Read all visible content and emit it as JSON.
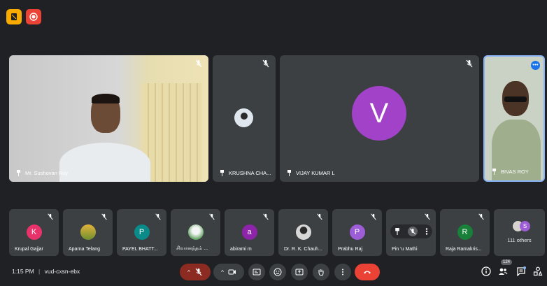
{
  "top_icons": [
    "files-icon",
    "record-icon"
  ],
  "main_tiles": [
    {
      "name": "Mr. Sushovan Roy"
    },
    {
      "name": "KRUSHNA CHA..."
    },
    {
      "name": "VIJAY KUMAR L",
      "avatar_letter": "V",
      "avatar_color": "#a142c9"
    },
    {
      "name": "BIVAS ROY"
    }
  ],
  "small_tiles": [
    {
      "name": "Krupal Gajjar",
      "letter": "K",
      "color": "#e8336a"
    },
    {
      "name": "Aparna Telang",
      "letter": "",
      "color": "#7a9a3a"
    },
    {
      "name": "PAYEL BHATT...",
      "letter": "P",
      "color": "#0b8a8a"
    },
    {
      "name": "சிவானந்தம் ...",
      "letter": "",
      "color": "#6aa86a"
    },
    {
      "name": "abirami m",
      "letter": "a",
      "color": "#8e24aa"
    },
    {
      "name": "Dr. R. K. Chauh...",
      "letter": "",
      "color": "#555"
    },
    {
      "name": "Prabhu Raj",
      "letter": "P",
      "color": "#9c5dd6"
    },
    {
      "name": "Pin   ‘u Mathi",
      "letter": "",
      "color": "#3c4043"
    },
    {
      "name": "Raja Ramakris...",
      "letter": "R",
      "color": "#188038"
    },
    {
      "name": "111 others",
      "letter": "S",
      "color": "#9c5dd6"
    }
  ],
  "bottom": {
    "time": "1:15 PM",
    "separator": "|",
    "meeting_code": "vud-cxsn-ebx",
    "people_count": "124"
  },
  "colors": {
    "background": "#202124",
    "tile": "#3c4043",
    "end_call": "#ea4335",
    "mic_off": "#8c2b22"
  }
}
